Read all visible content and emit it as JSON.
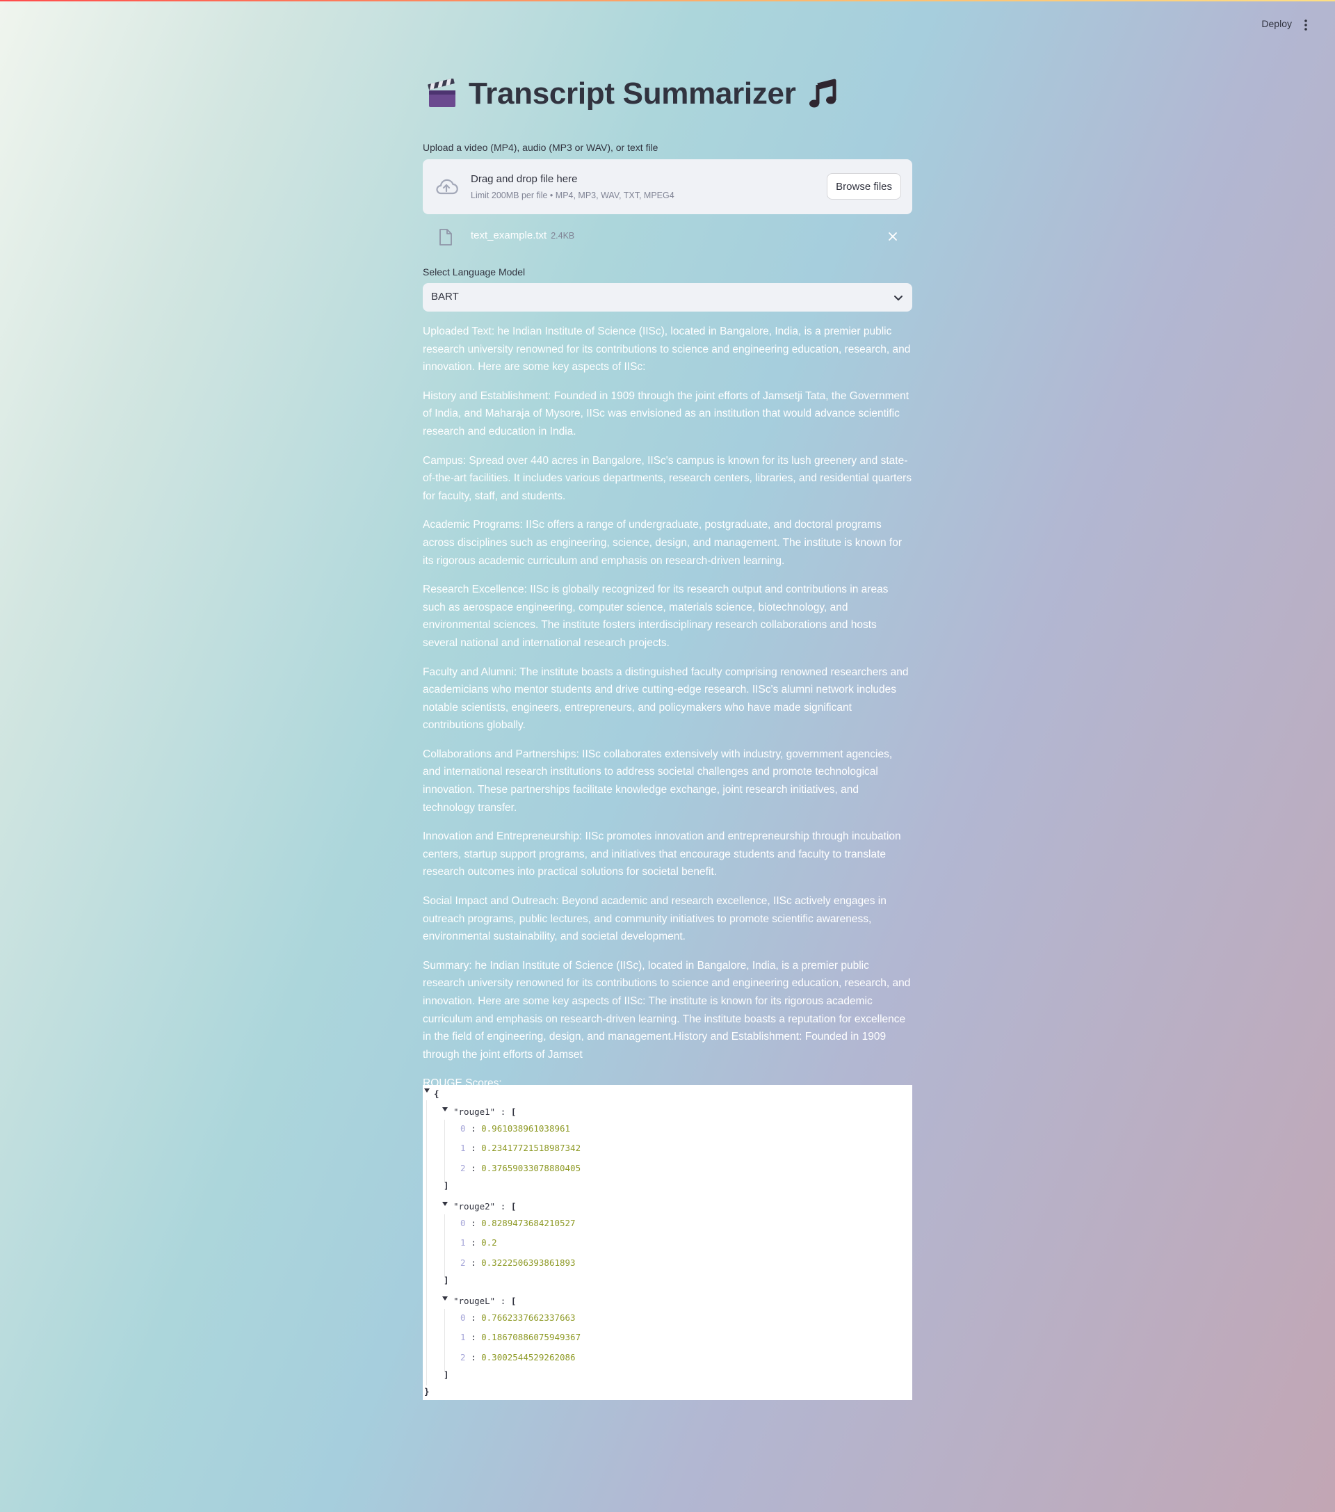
{
  "header": {
    "deploy_label": "Deploy",
    "menu_icon": "vertical-ellipsis-icon"
  },
  "page": {
    "title": "Transcript Summarizer",
    "title_prefix_icon": "clapper-board-icon",
    "title_suffix_icon": "music-note-icon"
  },
  "uploader": {
    "label": "Upload a video (MP4), audio (MP3 or WAV), or text file",
    "drop_title": "Drag and drop file here",
    "limit_text": "Limit 200MB per file • MP4, MP3, WAV, TXT, MPEG4",
    "browse_label": "Browse files",
    "file": {
      "name": "text_example.txt",
      "size": "2.4KB"
    }
  },
  "model_select": {
    "label": "Select Language Model",
    "value": "BART"
  },
  "output": {
    "paragraphs": [
      "Uploaded Text: he Indian Institute of Science (IISc), located in Bangalore, India, is a premier public research university renowned for its contributions to science and engineering education, research, and innovation. Here are some key aspects of IISc:",
      "History and Establishment: Founded in 1909 through the joint efforts of Jamsetji Tata, the Government of India, and Maharaja of Mysore, IISc was envisioned as an institution that would advance scientific research and education in India.",
      "Campus: Spread over 440 acres in Bangalore, IISc's campus is known for its lush greenery and state-of-the-art facilities. It includes various departments, research centers, libraries, and residential quarters for faculty, staff, and students.",
      "Academic Programs: IISc offers a range of undergraduate, postgraduate, and doctoral programs across disciplines such as engineering, science, design, and management. The institute is known for its rigorous academic curriculum and emphasis on research-driven learning.",
      "Research Excellence: IISc is globally recognized for its research output and contributions in areas such as aerospace engineering, computer science, materials science, biotechnology, and environmental sciences. The institute fosters interdisciplinary research collaborations and hosts several national and international research projects.",
      "Faculty and Alumni: The institute boasts a distinguished faculty comprising renowned researchers and academicians who mentor students and drive cutting-edge research. IISc's alumni network includes notable scientists, engineers, entrepreneurs, and policymakers who have made significant contributions globally.",
      "Collaborations and Partnerships: IISc collaborates extensively with industry, government agencies, and international research institutions to address societal challenges and promote technological innovation. These partnerships facilitate knowledge exchange, joint research initiatives, and technology transfer.",
      "Innovation and Entrepreneurship: IISc promotes innovation and entrepreneurship through incubation centers, startup support programs, and initiatives that encourage students and faculty to translate research outcomes into practical solutions for societal benefit.",
      "Social Impact and Outreach: Beyond academic and research excellence, IISc actively engages in outreach programs, public lectures, and community initiatives to promote scientific awareness, environmental sustainability, and societal development.",
      "Summary: he Indian Institute of Science (IISc), located in Bangalore, India, is a premier public research university renowned for its contributions to science and engineering education, research, and innovation. Here are some key aspects of IISc: The institute is known for its rigorous academic curriculum and emphasis on research-driven learning. The institute boasts a reputation for excellence in the field of engineering, design, and management.History and Establishment: Founded in 1909 through the joint efforts of Jamset",
      "ROUGE Scores:"
    ]
  },
  "rouge": {
    "open_brace": "{",
    "close_brace": "}",
    "open_bracket": "[",
    "close_bracket": "]",
    "colon": ":",
    "groups": [
      {
        "key": "\"rouge1\"",
        "items": [
          {
            "index": "0",
            "value": "0.961038961038961"
          },
          {
            "index": "1",
            "value": "0.23417721518987342"
          },
          {
            "index": "2",
            "value": "0.37659033078880405"
          }
        ]
      },
      {
        "key": "\"rouge2\"",
        "items": [
          {
            "index": "0",
            "value": "0.8289473684210527"
          },
          {
            "index": "1",
            "value": "0.2"
          },
          {
            "index": "2",
            "value": "0.3222506393861893"
          }
        ]
      },
      {
        "key": "\"rougeL\"",
        "items": [
          {
            "index": "0",
            "value": "0.7662337662337663"
          },
          {
            "index": "1",
            "value": "0.18670886075949367"
          },
          {
            "index": "2",
            "value": "0.3002544529262086"
          }
        ]
      }
    ]
  }
}
